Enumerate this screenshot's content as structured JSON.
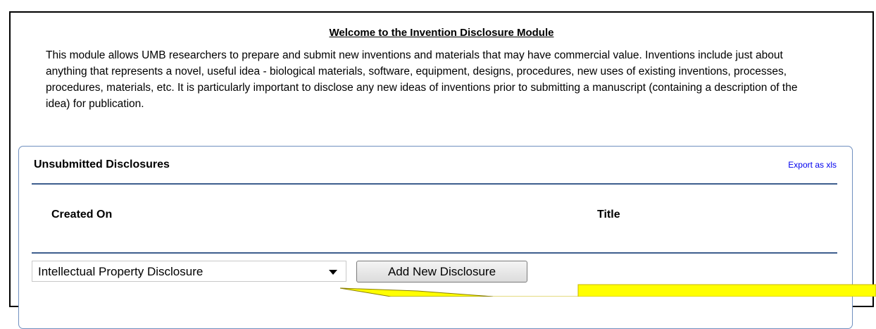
{
  "welcome": {
    "title": "Welcome to the Invention Disclosure Module",
    "intro": "This module allows UMB researchers to prepare and submit new inventions and materials that may have commercial value. Inventions include just about anything that represents a novel, useful idea - biological materials, software, equipment, designs, procedures, new uses of existing inventions, processes, procedures, materials, etc. It is particularly important to disclose any new ideas of inventions prior to submitting a manuscript (containing a description of the idea) for publication."
  },
  "unsubmitted": {
    "title": "Unsubmitted Disclosures",
    "export_label": "Export as xls",
    "columns": [
      "Created On",
      "Title"
    ],
    "rows": []
  },
  "form": {
    "disclosure_type_selected": "Intellectual Property Disclosure",
    "add_button_label": "Add New Disclosure"
  },
  "colors": {
    "panel_border": "#6f8fbf",
    "rule": "#3e5e8e",
    "link": "#0000ee",
    "callout_fill": "#ffff00",
    "callout_border": "#c8b400"
  }
}
